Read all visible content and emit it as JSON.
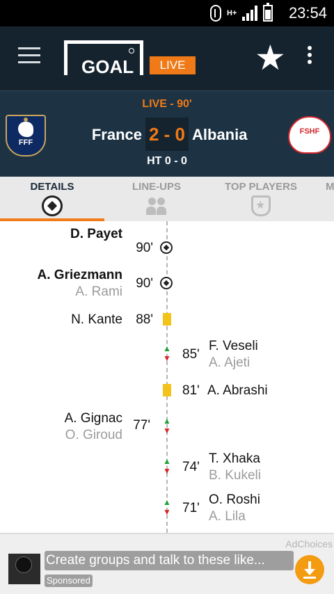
{
  "status_bar": {
    "time": "23:54",
    "network": "H+"
  },
  "app_header": {
    "logo_text": "GOAL",
    "live_label": "LIVE"
  },
  "match": {
    "status": "LIVE - 90'",
    "home_team": "France",
    "away_team": "Albania",
    "score": "2 - 0",
    "halftime": "HT 0 - 0",
    "home_crest_text": "FFF",
    "away_crest_text": "FSHF"
  },
  "tabs": [
    {
      "label": "DETAILS",
      "active": true
    },
    {
      "label": "LINE-UPS",
      "active": false
    },
    {
      "label": "TOP PLAYERS",
      "active": false
    },
    {
      "label": "M",
      "active": false
    }
  ],
  "events": [
    {
      "side": "home",
      "type": "goal",
      "player": "D. Payet",
      "minute": "90'",
      "assist": ""
    },
    {
      "side": "home",
      "type": "goal",
      "player": "A. Griezmann",
      "minute": "90'",
      "assist": "A. Rami"
    },
    {
      "side": "home",
      "type": "yellow-card",
      "player": "N. Kante",
      "minute": "88'"
    },
    {
      "side": "away",
      "type": "substitution",
      "player_in": "F. Veseli",
      "player_out": "A. Ajeti",
      "minute": "85'"
    },
    {
      "side": "away",
      "type": "yellow-card",
      "player": "A. Abrashi",
      "minute": "81'"
    },
    {
      "side": "home",
      "type": "substitution",
      "player_in": "A. Gignac",
      "player_out": "O. Giroud",
      "minute": "77'"
    },
    {
      "side": "away",
      "type": "substitution",
      "player_in": "T. Xhaka",
      "player_out": "B. Kukeli",
      "minute": "74'"
    },
    {
      "side": "away",
      "type": "substitution",
      "player_in": "O. Roshi",
      "player_out": "A. Lila",
      "minute": "71'"
    }
  ],
  "ad": {
    "adchoices": "AdChoices",
    "text": "Create groups and talk to these like...",
    "sponsored": "Sponsored"
  },
  "colors": {
    "accent": "#ef7a17",
    "header_bg": "#15232f",
    "score_bg": "#1d3344",
    "yellow_card": "#f3c31a"
  }
}
